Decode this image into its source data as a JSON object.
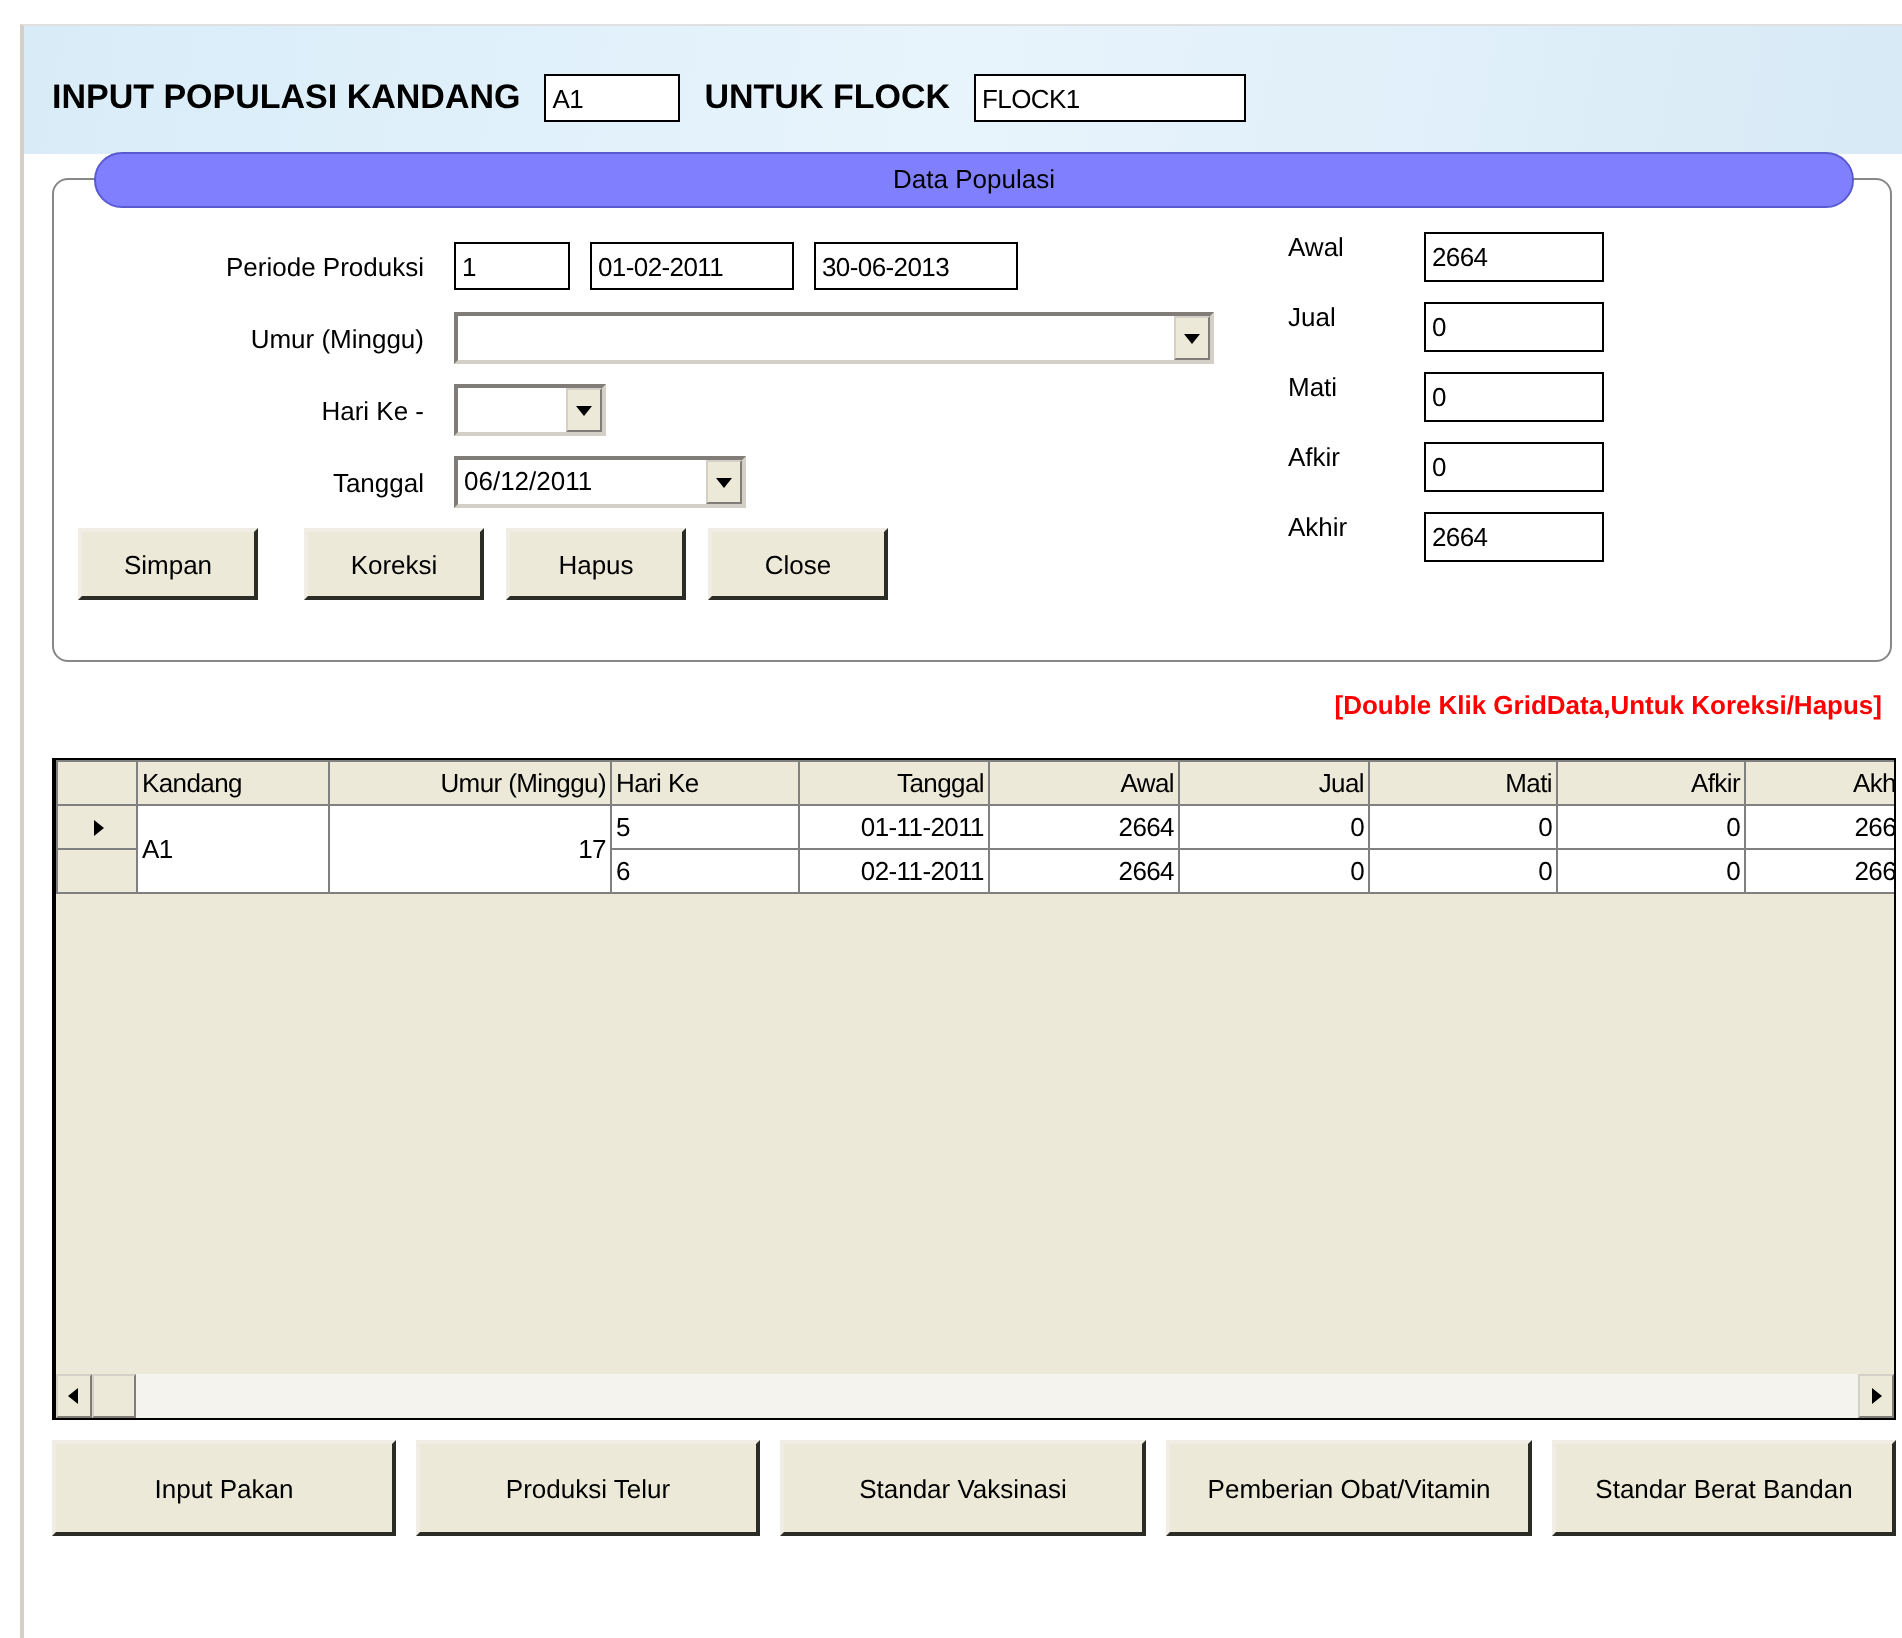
{
  "header": {
    "title": "INPUT POPULASI KANDANG",
    "kandang": "A1",
    "flock_label": "UNTUK FLOCK",
    "flock": "FLOCK1"
  },
  "panel": {
    "title": "Data Populasi",
    "left_rows": [
      {
        "label": "Periode Produksi",
        "kind": "fields",
        "values": [
          "1",
          "01-02-2011",
          "30-06-2013"
        ]
      },
      {
        "label": "Umur (Minggu)",
        "kind": "combo"
      },
      {
        "label": "Hari Ke -",
        "kind": "combo"
      },
      {
        "label": "Tanggal",
        "kind": "combo",
        "value": "06/12/2011"
      }
    ],
    "right_rows": [
      {
        "label": "Awal",
        "value": "2664"
      },
      {
        "label": "Jual",
        "value": "0"
      },
      {
        "label": "Mati",
        "value": "0"
      },
      {
        "label": "Afkir",
        "value": "0"
      },
      {
        "label": "Akhir",
        "value": "2664"
      }
    ],
    "buttons": [
      "Simpan",
      "Koreksi",
      "Hapus",
      "Close"
    ]
  },
  "hint": "[Double Klik GridData,Untuk Koreksi/Hapus]",
  "grid": {
    "columns": [
      "Kandang",
      "Umur (Minggu)",
      "Hari Ke",
      "Tanggal",
      "Awal",
      "Jual",
      "Mati",
      "Afkir",
      "Akh"
    ],
    "groups": [
      {
        "kandang": "A1",
        "umur": "17",
        "rows": [
          {
            "current": true,
            "cells": [
              "5",
              "01-11-2011",
              "2664",
              "0",
              "0",
              "0",
              "266"
            ]
          },
          {
            "current": false,
            "cells": [
              "6",
              "02-11-2011",
              "2664",
              "0",
              "0",
              "0",
              "266"
            ]
          }
        ]
      }
    ]
  },
  "bottom_buttons": [
    "Input Pakan",
    "Produksi Telur",
    "Standar Vaksinasi",
    "Pemberian Obat/Vitamin",
    "Standar Berat Bandan"
  ]
}
